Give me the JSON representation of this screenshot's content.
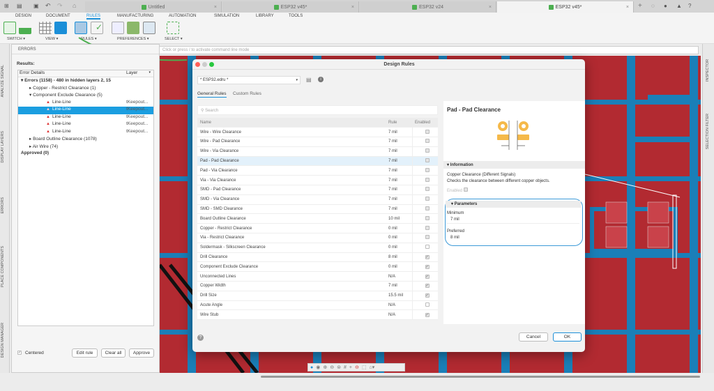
{
  "tabs": [
    {
      "label": "Untitled"
    },
    {
      "label": "ESP32 v45*"
    },
    {
      "label": "ESP32 v24"
    },
    {
      "label": "ESP32 v45*"
    }
  ],
  "ribbon": {
    "tabs": [
      "DESIGN",
      "DOCUMENT",
      "RULES",
      "MANUFACTURING",
      "AUTOMATION",
      "SIMULATION",
      "LIBRARY",
      "TOOLS"
    ],
    "active": "RULES",
    "groups": [
      "SWITCH ▾",
      "VIEW ▾",
      "RULES ▾",
      "PREFERENCES ▾",
      "SELECT ▾"
    ]
  },
  "command_placeholder": "Click or press / to activate command line mode",
  "left_strip": [
    "ANALYZE SIGNAL",
    "DISPLAY LAYERS",
    "ERRORS",
    "PLACE COMPONENTS",
    "DESIGN MANAGER"
  ],
  "right_strip": [
    "INSPECTOR",
    "SELECTION FILTER"
  ],
  "errors": {
    "title": "ERRORS",
    "results_label": "Results:",
    "col_details": "Error Details",
    "col_layer": "Layer",
    "tree": [
      {
        "text": "▾ Errors (1158) - 480 in hidden layers 2, 15",
        "level": 0,
        "bold": true
      },
      {
        "text": "▸ Copper - Restrict Clearance (1)",
        "level": 1
      },
      {
        "text": "▾ Component Exclude Clearance (5)",
        "level": 1
      },
      {
        "text": "Line-Line",
        "level": 2,
        "warn": true,
        "layer": "tKeepout..."
      },
      {
        "text": "Line-Line",
        "level": 2,
        "warn": true,
        "layer": "tKeepout...",
        "selected": true
      },
      {
        "text": "Line-Line",
        "level": 2,
        "warn": true,
        "layer": "tKeepout..."
      },
      {
        "text": "Line-Line",
        "level": 2,
        "warn": true,
        "layer": "tKeepout..."
      },
      {
        "text": "Line-Line",
        "level": 2,
        "warn": true,
        "layer": "tKeepout..."
      },
      {
        "text": "▸ Board Outline Clearance (1078)",
        "level": 1
      },
      {
        "text": "▸ Air Wire (74)",
        "level": 1
      },
      {
        "text": "Approved (0)",
        "level": 0,
        "bold": true
      }
    ],
    "centered_label": "Centered",
    "edit_rule": "Edit rule",
    "clear_all": "Clear all",
    "approve": "Approve"
  },
  "dialog": {
    "title": "Design Rules",
    "file": "* ESP32.edru *",
    "tabs": [
      "General Rules",
      "Custom Rules"
    ],
    "search_placeholder": "Search",
    "columns": [
      "Name",
      "Rule",
      "Enabled"
    ],
    "rules": [
      {
        "name": "Wire - Wire Clearance",
        "rule": "7 mil",
        "enabled": true,
        "locked": true
      },
      {
        "name": "Wire - Pad Clearance",
        "rule": "7 mil",
        "enabled": true,
        "locked": true
      },
      {
        "name": "Wire - Via Clearance",
        "rule": "7 mil",
        "enabled": true,
        "locked": true
      },
      {
        "name": "Pad - Pad Clearance",
        "rule": "7 mil",
        "enabled": true,
        "locked": true,
        "selected": true
      },
      {
        "name": "Pad - Via Clearance",
        "rule": "7 mil",
        "enabled": true,
        "locked": true
      },
      {
        "name": "Via - Via Clearance",
        "rule": "7 mil",
        "enabled": true,
        "locked": true
      },
      {
        "name": "SMD - Pad Clearance",
        "rule": "7 mil",
        "enabled": true,
        "locked": true
      },
      {
        "name": "SMD - Via Clearance",
        "rule": "7 mil",
        "enabled": true,
        "locked": true
      },
      {
        "name": "SMD - SMD Clearance",
        "rule": "7 mil",
        "enabled": true,
        "locked": true
      },
      {
        "name": "Board Outline Clearance",
        "rule": "10 mil",
        "enabled": true,
        "locked": true
      },
      {
        "name": "Copper - Restrict Clearance",
        "rule": "0 mil",
        "enabled": true,
        "locked": true
      },
      {
        "name": "Via - Restrict Clearance",
        "rule": "0 mil",
        "enabled": true,
        "locked": true
      },
      {
        "name": "Soldermask - Silkscreen Clearance",
        "rule": "0 mil",
        "enabled": false
      },
      {
        "name": "Drill Clearance",
        "rule": "8 mil",
        "enabled": true
      },
      {
        "name": "Component Exclude Clearance",
        "rule": "0 mil",
        "enabled": true
      },
      {
        "name": "Unconnected Lines",
        "rule": "N/A",
        "enabled": true
      },
      {
        "name": "Copper Width",
        "rule": "7 mil",
        "enabled": true
      },
      {
        "name": "Drill Size",
        "rule": "15.5 mil",
        "enabled": true
      },
      {
        "name": "Acute Angle",
        "rule": "N/A",
        "enabled": false
      },
      {
        "name": "Wire Stub",
        "rule": "N/A",
        "enabled": true
      }
    ],
    "detail": {
      "title": "Pad - Pad Clearance",
      "info_header": "Information",
      "info_line1": "Copper Clearance (Different Signals)",
      "info_line2": "Checks the clearance between different copper objects.",
      "enabled_label": "Enabled",
      "params_header": "Parameters",
      "min_label": "Minimum",
      "min_value": "7 mil",
      "pref_label": "Preferred",
      "pref_value": "8 mil"
    },
    "cancel": "Cancel",
    "ok": "OK"
  },
  "colors": {
    "accent": "#1b8fd8",
    "pcb_red": "#b22a31",
    "pcb_blue": "#1a7fb8",
    "pad": "#f5b94a"
  }
}
